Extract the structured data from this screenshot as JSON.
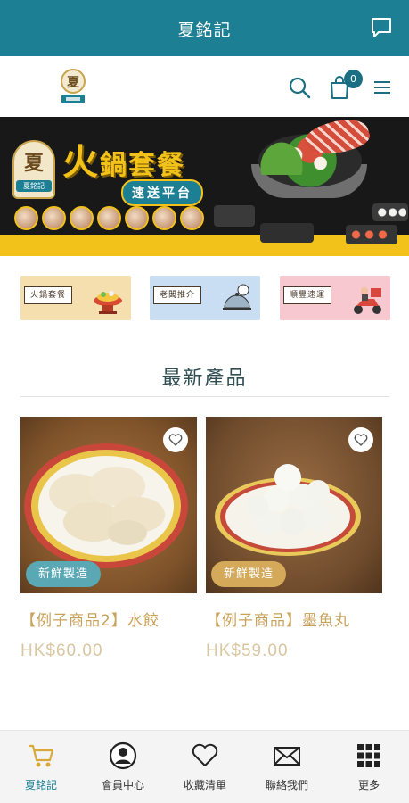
{
  "app_bar": {
    "title": "夏銘記",
    "chat_icon": "chat-bubble-icon"
  },
  "header": {
    "logo_icon": "brand-logo-icon",
    "search_icon": "search-icon",
    "cart_icon": "shopping-bag-icon",
    "cart_count": "0",
    "menu_icon": "hamburger-menu-icon"
  },
  "banner": {
    "seal_char": "夏",
    "seal_name": "夏銘記",
    "title_big": "火",
    "title_rest": "鍋套餐",
    "subtitle": "速送平台"
  },
  "categories": [
    {
      "label": "火鍋套餐",
      "icon": "hotpot-icon"
    },
    {
      "label": "老闆推介",
      "icon": "chef-cloche-icon"
    },
    {
      "label": "順豐速運",
      "icon": "delivery-scooter-icon"
    }
  ],
  "section": {
    "title": "最新產品"
  },
  "products": [
    {
      "name": "【例子商品2】水餃",
      "price": "HK$60.00",
      "badge": "新鮮製造",
      "badge_color": "#5aa8b4",
      "favorite_icon": "heart-icon"
    },
    {
      "name": "【例子商品】墨魚丸",
      "price": "HK$59.00",
      "badge": "新鮮製造",
      "badge_color": "#d4a95a",
      "favorite_icon": "heart-icon"
    }
  ],
  "bottom_nav": [
    {
      "label": "夏銘記",
      "icon": "cart-icon",
      "active": true
    },
    {
      "label": "會員中心",
      "icon": "user-avatar-icon",
      "active": false
    },
    {
      "label": "收藏清單",
      "icon": "heart-icon",
      "active": false
    },
    {
      "label": "聯絡我們",
      "icon": "envelope-icon",
      "active": false
    },
    {
      "label": "更多",
      "icon": "grid-icon",
      "active": false
    }
  ],
  "colors": {
    "brand": "#1c7f93",
    "accent_gold": "#c8a25a"
  }
}
